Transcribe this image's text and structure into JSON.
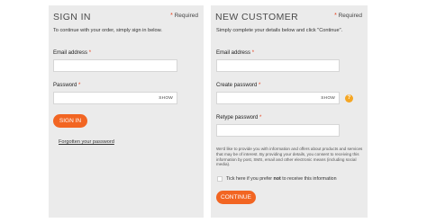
{
  "signin": {
    "title": "SIGN IN",
    "required_star": "*",
    "required_label": "Required",
    "intro": "To continue with your order, simply sign in below.",
    "email_label": "Email address",
    "email_value": "",
    "password_label": "Password",
    "password_value": "",
    "show_label": "SHOW",
    "signin_button": "SIGN IN",
    "forgot_link": "Forgotten your password"
  },
  "new_customer": {
    "title": "NEW CUSTOMER",
    "required_star": "*",
    "required_label": "Required",
    "intro": "Simply complete your details below and click \"Continue\".",
    "email_label": "Email address",
    "email_value": "",
    "create_password_label": "Create password",
    "create_password_value": "",
    "show_label": "SHOW",
    "help_icon_glyph": "?",
    "retype_password_label": "Retype password",
    "retype_password_value": "",
    "marketing_text": "We'd like to provide you with information and offers about products and services that may be of interest. By providing your details, you consent to receiving this information by post, SMS, email and other electronic means (including social media).",
    "optout_prefix": "Tick here if you prefer ",
    "optout_bold": "not",
    "optout_suffix": " to receive this information",
    "continue_button": "CONTINUE"
  },
  "colors": {
    "accent": "#f26522",
    "help": "#f5a623",
    "panel_bg": "#ebebeb"
  }
}
